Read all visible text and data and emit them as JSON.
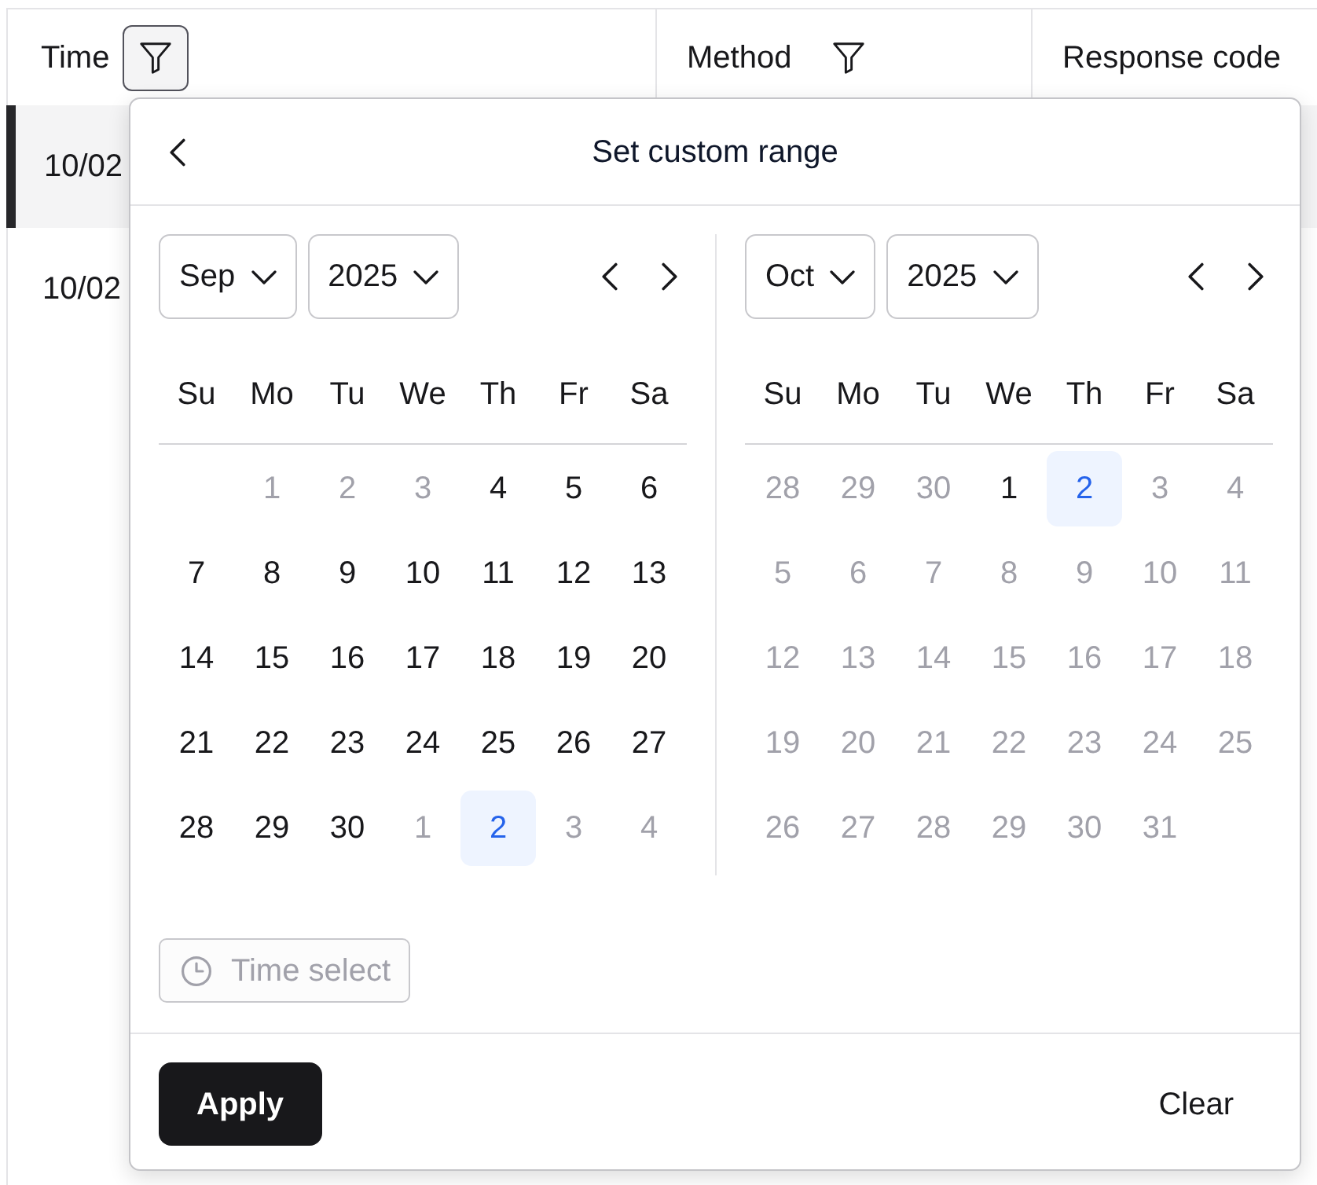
{
  "table": {
    "columns": [
      {
        "label": "Time",
        "filter_open": true
      },
      {
        "label": "Method",
        "filter_open": false
      },
      {
        "label": "Response code"
      }
    ],
    "rows": [
      {
        "time": "10/02",
        "selected": true
      },
      {
        "time": "10/02",
        "selected": false
      }
    ]
  },
  "popover": {
    "title": "Set custom range",
    "calendars": [
      {
        "month": "Sep",
        "year": "2025",
        "weekdays": [
          "Su",
          "Mo",
          "Tu",
          "We",
          "Th",
          "Fr",
          "Sa"
        ],
        "weeks": [
          [
            {
              "day": "1",
              "muted": true,
              "selected": false
            },
            {
              "day": "2",
              "muted": true,
              "selected": false
            },
            {
              "day": "3",
              "muted": true,
              "selected": false
            },
            {
              "day": "4",
              "muted": false,
              "selected": false
            },
            {
              "day": "5",
              "muted": false,
              "selected": false
            },
            {
              "day": "6",
              "muted": false,
              "selected": false
            }
          ],
          [
            {
              "day": "7",
              "muted": false,
              "selected": false
            },
            {
              "day": "8",
              "muted": false,
              "selected": false
            },
            {
              "day": "9",
              "muted": false,
              "selected": false
            },
            {
              "day": "10",
              "muted": false,
              "selected": false
            },
            {
              "day": "11",
              "muted": false,
              "selected": false
            },
            {
              "day": "12",
              "muted": false,
              "selected": false
            },
            {
              "day": "13",
              "muted": false,
              "selected": false
            }
          ],
          [
            {
              "day": "14",
              "muted": false,
              "selected": false
            },
            {
              "day": "15",
              "muted": false,
              "selected": false
            },
            {
              "day": "16",
              "muted": false,
              "selected": false
            },
            {
              "day": "17",
              "muted": false,
              "selected": false
            },
            {
              "day": "18",
              "muted": false,
              "selected": false
            },
            {
              "day": "19",
              "muted": false,
              "selected": false
            },
            {
              "day": "20",
              "muted": false,
              "selected": false
            }
          ],
          [
            {
              "day": "21",
              "muted": false,
              "selected": false
            },
            {
              "day": "22",
              "muted": false,
              "selected": false
            },
            {
              "day": "23",
              "muted": false,
              "selected": false
            },
            {
              "day": "24",
              "muted": false,
              "selected": false
            },
            {
              "day": "25",
              "muted": false,
              "selected": false
            },
            {
              "day": "26",
              "muted": false,
              "selected": false
            },
            {
              "day": "27",
              "muted": false,
              "selected": false
            }
          ],
          [
            {
              "day": "28",
              "muted": false,
              "selected": false
            },
            {
              "day": "29",
              "muted": false,
              "selected": false
            },
            {
              "day": "30",
              "muted": false,
              "selected": false
            },
            {
              "day": "1",
              "muted": true,
              "selected": false
            },
            {
              "day": "2",
              "muted": false,
              "selected": true
            },
            {
              "day": "3",
              "muted": true,
              "selected": false
            },
            {
              "day": "4",
              "muted": true,
              "selected": false
            }
          ]
        ]
      },
      {
        "month": "Oct",
        "year": "2025",
        "weekdays": [
          "Su",
          "Mo",
          "Tu",
          "We",
          "Th",
          "Fr",
          "Sa"
        ],
        "weeks": [
          [
            {
              "day": "28",
              "muted": true,
              "selected": false
            },
            {
              "day": "29",
              "muted": true,
              "selected": false
            },
            {
              "day": "30",
              "muted": true,
              "selected": false
            },
            {
              "day": "1",
              "muted": false,
              "selected": false
            },
            {
              "day": "2",
              "muted": false,
              "selected": true
            },
            {
              "day": "3",
              "muted": true,
              "selected": false
            },
            {
              "day": "4",
              "muted": true,
              "selected": false
            }
          ],
          [
            {
              "day": "5",
              "muted": true,
              "selected": false
            },
            {
              "day": "6",
              "muted": true,
              "selected": false
            },
            {
              "day": "7",
              "muted": true,
              "selected": false
            },
            {
              "day": "8",
              "muted": true,
              "selected": false
            },
            {
              "day": "9",
              "muted": true,
              "selected": false
            },
            {
              "day": "10",
              "muted": true,
              "selected": false
            },
            {
              "day": "11",
              "muted": true,
              "selected": false
            }
          ],
          [
            {
              "day": "12",
              "muted": true,
              "selected": false
            },
            {
              "day": "13",
              "muted": true,
              "selected": false
            },
            {
              "day": "14",
              "muted": true,
              "selected": false
            },
            {
              "day": "15",
              "muted": true,
              "selected": false
            },
            {
              "day": "16",
              "muted": true,
              "selected": false
            },
            {
              "day": "17",
              "muted": true,
              "selected": false
            },
            {
              "day": "18",
              "muted": true,
              "selected": false
            }
          ],
          [
            {
              "day": "19",
              "muted": true,
              "selected": false
            },
            {
              "day": "20",
              "muted": true,
              "selected": false
            },
            {
              "day": "21",
              "muted": true,
              "selected": false
            },
            {
              "day": "22",
              "muted": true,
              "selected": false
            },
            {
              "day": "23",
              "muted": true,
              "selected": false
            },
            {
              "day": "24",
              "muted": true,
              "selected": false
            },
            {
              "day": "25",
              "muted": true,
              "selected": false
            }
          ],
          [
            {
              "day": "26",
              "muted": true,
              "selected": false
            },
            {
              "day": "27",
              "muted": true,
              "selected": false
            },
            {
              "day": "28",
              "muted": true,
              "selected": false
            },
            {
              "day": "29",
              "muted": true,
              "selected": false
            },
            {
              "day": "30",
              "muted": true,
              "selected": false
            },
            {
              "day": "31",
              "muted": true,
              "selected": false
            }
          ]
        ]
      }
    ],
    "time_select": {
      "label": "Time select",
      "disabled": true
    },
    "apply_label": "Apply",
    "clear_label": "Clear"
  }
}
